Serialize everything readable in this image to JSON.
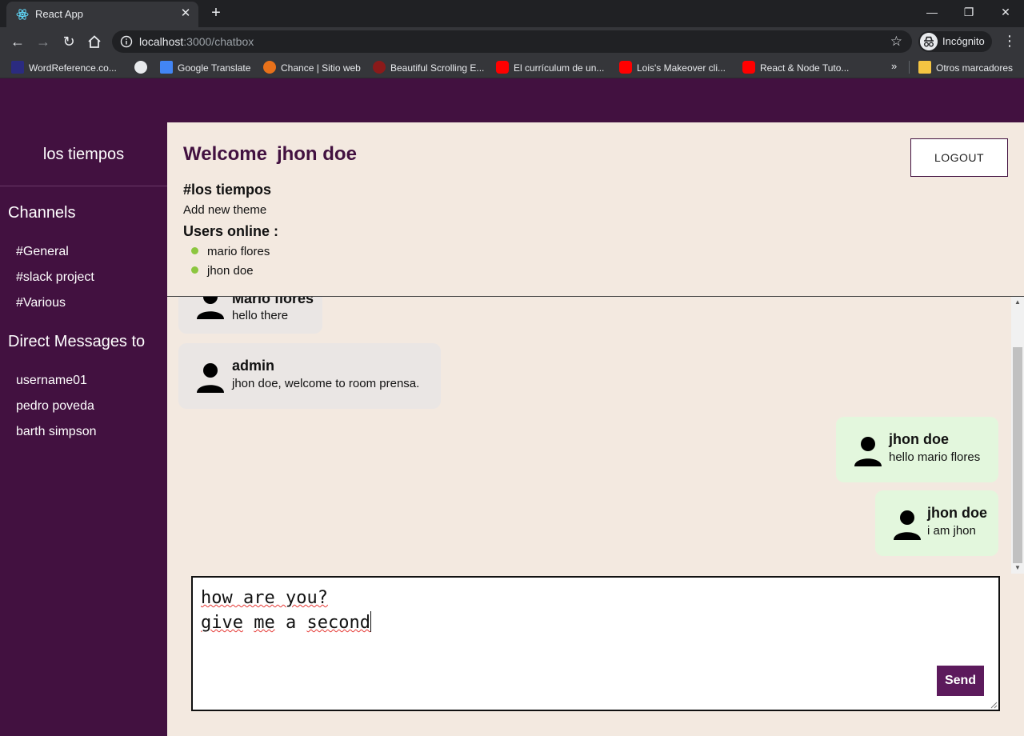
{
  "browser": {
    "tab_title": "React App",
    "url_host": "localhost",
    "url_path": ":3000/chatbox",
    "profile_label": "Incógnito",
    "bookmarks": [
      {
        "label": "WordReference.co...",
        "icon": "wordreference-icon",
        "color": "#c0392b"
      },
      {
        "label": "",
        "icon": "globe-icon",
        "color": "#e8eaed"
      },
      {
        "label": "Google Translate",
        "icon": "google-translate-icon",
        "color": "#4285f4"
      },
      {
        "label": "Chance | Sitio web",
        "icon": "chance-icon",
        "color": "#e8711a"
      },
      {
        "label": "Beautiful Scrolling E...",
        "icon": "site-icon",
        "color": "#8b1a1a"
      },
      {
        "label": "El currículum de un...",
        "icon": "youtube-icon",
        "color": "#ff0000"
      },
      {
        "label": "Lois's Makeover cli...",
        "icon": "youtube-icon",
        "color": "#ff0000"
      },
      {
        "label": "React & Node Tuto...",
        "icon": "youtube-icon",
        "color": "#ff0000"
      }
    ],
    "other_bookmarks": "Otros marcadores"
  },
  "sidebar": {
    "brand": "los tiempos",
    "channels_heading": "Channels",
    "channels": [
      "#General",
      "#slack project",
      "#Various"
    ],
    "dm_heading": "Direct Messages to",
    "direct_messages": [
      "username01",
      "pedro poveda",
      "barth simpson"
    ]
  },
  "header": {
    "welcome_label": "Welcome",
    "welcome_name": "jhon doe",
    "logout_label": "LOGOUT",
    "room": "#los tiempos",
    "add_theme": "Add new theme",
    "users_online_label": "Users online :",
    "users_online": [
      "mario flores",
      "jhon doe"
    ]
  },
  "messages": [
    {
      "author": "Mario flores",
      "text": "hello there",
      "mine": false
    },
    {
      "author": "admin",
      "text": "jhon doe, welcome to room prensa.",
      "mine": false
    },
    {
      "author": "jhon doe",
      "text": "hello mario flores",
      "mine": true
    },
    {
      "author": "jhon doe",
      "text": "i am jhon",
      "mine": true
    }
  ],
  "composer": {
    "line1": "how are you?",
    "line2_words": [
      "give",
      "me",
      "a",
      "second"
    ],
    "send_label": "Send"
  },
  "colors": {
    "sidebar_bg": "#421140",
    "page_bg": "#f3e9e0",
    "send_bg": "#5c1a5c",
    "online_dot": "#8cc63f",
    "own_bubble": "#e3f7dd",
    "other_bubble": "#eae6e4"
  }
}
